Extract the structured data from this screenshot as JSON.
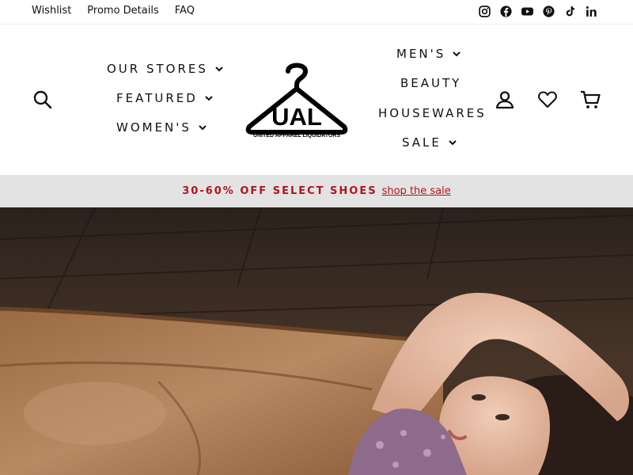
{
  "topbar": {
    "links": [
      "Wishlist",
      "Promo Details",
      "FAQ"
    ],
    "social": [
      "instagram-icon",
      "facebook-icon",
      "youtube-icon",
      "pinterest-icon",
      "tiktok-icon",
      "linkedin-icon"
    ]
  },
  "header": {
    "nav_left": [
      "OUR STORES",
      "FEATURED",
      "WOMEN'S"
    ],
    "nav_right": [
      "MEN'S",
      "BEAUTY",
      "HOUSEWARES",
      "SALE"
    ],
    "logo_text": "UAL",
    "logo_caption": "UNITED APPAREL LIQUIDATORS",
    "icons": [
      "search-icon",
      "account-icon",
      "wishlist-heart-icon",
      "cart-icon"
    ]
  },
  "announcement": {
    "promo": "30-60% OFF SELECT SHOES",
    "link": "shop the sale",
    "color": "#b0151f"
  },
  "hero": {
    "image": "woman-on-leather-couch-photo"
  }
}
